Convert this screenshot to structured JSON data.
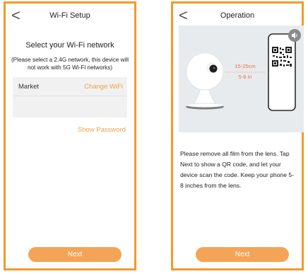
{
  "wifi_setup": {
    "nav_back_glyph": "<",
    "title": "Wi-Fi Setup",
    "heading": "Select your Wi-Fi network",
    "subheading": "(Please select a 2.4G network, this device will not work with 5G Wi-Fi networks)",
    "network_name": "Market",
    "change_wifi_label": "Change WiFi",
    "password_value": "",
    "show_password_label": "Show Password",
    "next_label": "Next"
  },
  "operation": {
    "nav_back_glyph": "<",
    "title": "Operation",
    "distance_cm": "15-25cm",
    "distance_in": "5-8 in",
    "instruction": "Please remove all film from the lens. Tap Next to show a QR code, and let your device scan the code. Keep your phone 5-8 inches from the lens.",
    "next_label": "Next"
  },
  "colors": {
    "accent_border": "#f39a2e",
    "accent_text": "#f0a14a",
    "button": "#f4a456",
    "distance_text": "#e8734a"
  },
  "icons": [
    "back-chevron-icon",
    "speaker-icon",
    "camera-illustration",
    "phone-qr-illustration"
  ]
}
